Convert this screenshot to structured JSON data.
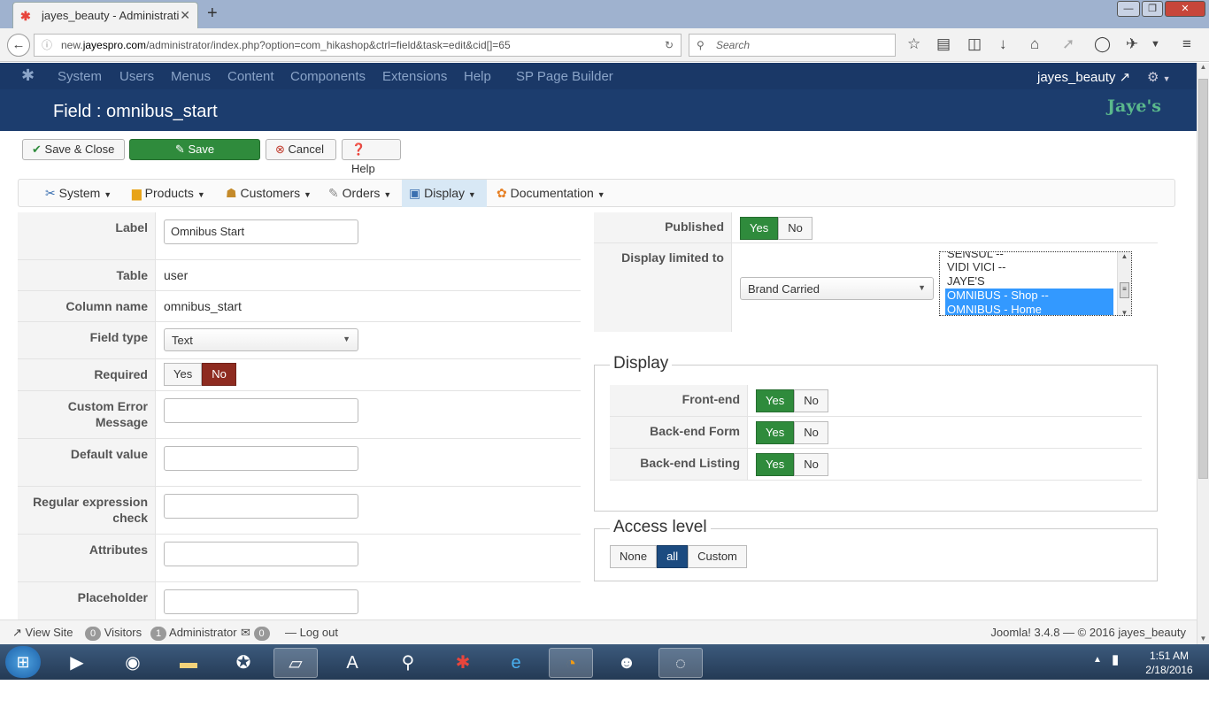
{
  "browser": {
    "tab_title": "jayes_beauty - Administrati...",
    "url_prefix": "new.",
    "url_domain": "jayespro.com",
    "url_path": "/administrator/index.php?option=com_hikashop&ctrl=field&task=edit&cid[]=65",
    "search_placeholder": "Search"
  },
  "joomla_menu": {
    "items": [
      "System",
      "Users",
      "Menus",
      "Content",
      "Components",
      "Extensions",
      "Help",
      "SP Page Builder"
    ],
    "user": "jayes_beauty"
  },
  "header": {
    "title": "Field : omnibus_start",
    "brand": "Jaye's"
  },
  "toolbar": {
    "save_close": "Save & Close",
    "save": "Save",
    "cancel": "Cancel",
    "help": "Help"
  },
  "submenu": {
    "items": [
      "System",
      "Products",
      "Customers",
      "Orders",
      "Display",
      "Documentation"
    ],
    "active": "Display"
  },
  "form": {
    "label": {
      "label": "Label",
      "value": "Omnibus Start"
    },
    "table": {
      "label": "Table",
      "value": "user"
    },
    "column_name": {
      "label": "Column name",
      "value": "omnibus_start"
    },
    "field_type": {
      "label": "Field type",
      "value": "Text"
    },
    "required": {
      "label": "Required",
      "yes": "Yes",
      "no": "No",
      "selected": "No"
    },
    "custom_error_line1": "Custom Error",
    "custom_error_line2": "Message",
    "default_value": "Default value",
    "regex_line1": "Regular expression",
    "regex_line2": "check",
    "attributes": "Attributes",
    "placeholder": "Placeholder"
  },
  "right": {
    "published": {
      "label": "Published",
      "yes": "Yes",
      "no": "No",
      "selected": "Yes"
    },
    "display_limited": {
      "label": "Display limited to",
      "select_value": "Brand Carried",
      "options": [
        "SENSUL --",
        "VIDI VICI --",
        "JAYE'S",
        "OMNIBUS - Shop --",
        "OMNIBUS - Home"
      ],
      "selected": [
        "OMNIBUS - Shop --",
        "OMNIBUS - Home"
      ]
    },
    "display_legend": "Display",
    "front_end": {
      "label": "Front-end",
      "yes": "Yes",
      "no": "No",
      "selected": "Yes"
    },
    "backend_form": {
      "label": "Back-end Form",
      "yes": "Yes",
      "no": "No",
      "selected": "Yes"
    },
    "backend_listing": {
      "label": "Back-end Listing",
      "yes": "Yes",
      "no": "No",
      "selected": "Yes"
    },
    "access_legend": "Access level",
    "access": {
      "none": "None",
      "all": "all",
      "custom": "Custom",
      "selected": "all"
    }
  },
  "status": {
    "view_site": "View Site",
    "visitors_count": "0",
    "visitors": "Visitors",
    "admin_count": "1",
    "administrator": "Administrator",
    "messages_count": "0",
    "logout": "Log out",
    "footer": "Joomla! 3.4.8 — © 2016 jayes_beauty"
  },
  "taskbar": {
    "time": "1:51 AM",
    "date": "2/18/2016"
  },
  "colors": {
    "joomla_nav": "#1a3867",
    "title_bar": "#1c3d6e",
    "green": "#2f8b3c",
    "red": "#8e2b20",
    "selection": "#3399ff"
  }
}
